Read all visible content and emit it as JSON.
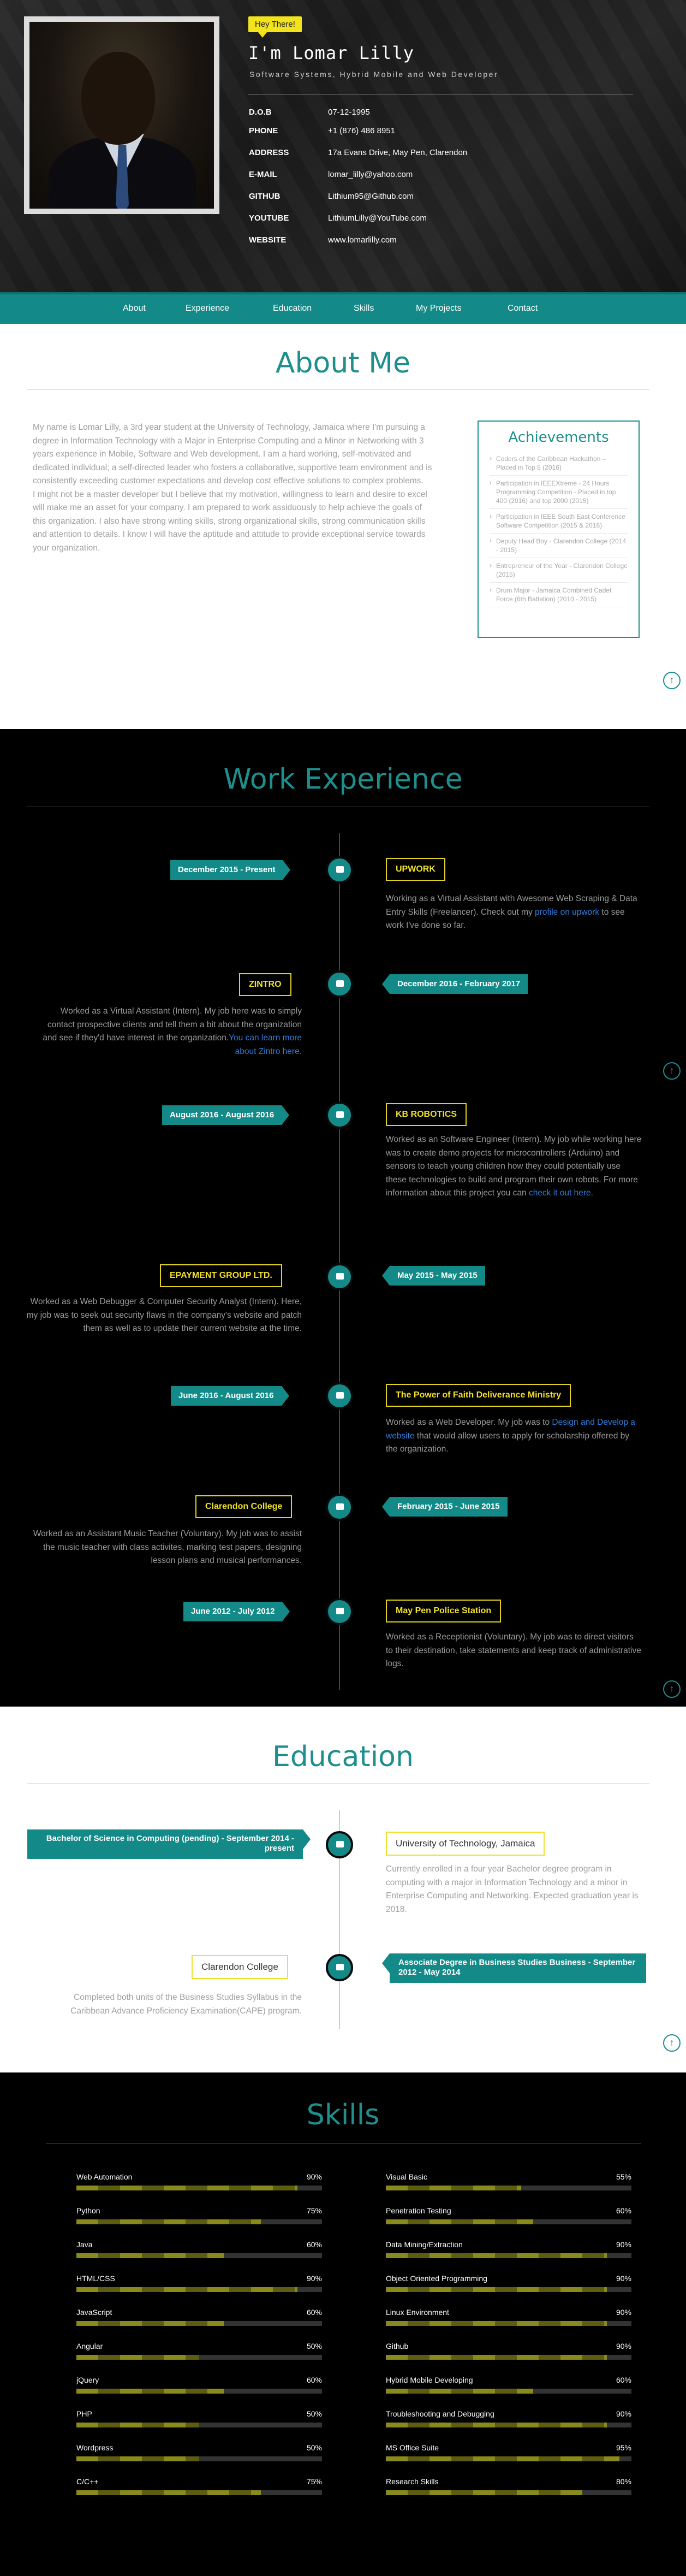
{
  "hero": {
    "badge": "Hey There!",
    "name": "I'm Lomar Lilly",
    "tagline": "Software Systems, Hybrid Mobile and Web Developer",
    "info": [
      {
        "k": "D.O.B",
        "v": "07-12-1995"
      },
      {
        "k": "PHONE",
        "v": "+1 (876) 486 8951"
      },
      {
        "k": "ADDRESS",
        "v": "17a Evans Drive, May Pen, Clarendon"
      },
      {
        "k": "E-MAIL",
        "v": "lomar_lilly@yahoo.com"
      },
      {
        "k": "GITHUB",
        "v": "Lithium95@Github.com"
      },
      {
        "k": "YOUTUBE",
        "v": "LithiumLilly@YouTube.com"
      },
      {
        "k": "WEBSITE",
        "v": "www.lomarlilly.com"
      }
    ]
  },
  "nav": [
    "About",
    "Experience",
    "Education",
    "Skills",
    "My Projects",
    "Contact"
  ],
  "about": {
    "title": "About Me",
    "p1": "My name is Lomar Lilly, a 3rd year student at the University of Technology, Jamaica where I'm pursuing a degree in Information Technology with a Major in Enterprise Computing and a Minor in Networking with 3 years experience in Mobile, Software and Web development. I am a hard working, self-motivated and dedicated individual; a self-directed leader who fosters a collaborative, supportive team environment and is consistently exceeding customer expectations and develop cost effective solutions to complex problems.",
    "p2": "I might not be a master developer but I believe that my motivation, willingness to learn and desire to excel will make me an asset for your company. I am prepared to work assiduously to help achieve the goals of this organization. I also have strong writing skills, strong organizational skills, strong communication skills and attention to details. I know I will have the aptitude and attitude to provide exceptional service towards your organization.",
    "ach_title": "Achievements",
    "achievements": [
      "Coders of the Caribbean Hackathon – Placed in Top 5 (2016)",
      "Participation in IEEEXtreme - 24 Hours Programming Competition - Placed in top 400 (2016) and top 2000 (2015)",
      "Participation in IEEE South East Conference Software Competition (2015 & 2016)",
      "Deputy Head Boy - Clarendon College (2014 - 2015)",
      "Entrepreneur of the Year - Clarendon College (2015)",
      "Drum Major - Jamaica Combined Cadet Force (6th Battalion) (2010 - 2015)"
    ]
  },
  "work": {
    "title": "Work Experience",
    "items": [
      {
        "date": "December 2015 - Present",
        "company": "UPWORK",
        "desc": "Working as a Virtual Assistant with Awesome Web Scraping & Data Entry Skills (Freelancer). Check out my ",
        "link": "profile on upwork",
        "after": " to see work I've done so far."
      },
      {
        "date": "December 2016 - February 2017",
        "company": "ZINTRO",
        "desc": "Worked as a Virtual Assistant (Intern). My job here was to simply contact prospective clients and tell them a bit about the organization and see if they'd have interest in the organization.",
        "link": "You can learn more about Zintro here.",
        "after": ""
      },
      {
        "date": "August 2016 - August 2016",
        "company": "KB ROBOTICS",
        "desc": "Worked as an Software Engineer (Intern). My job while working here was to create demo projects for microcontrollers (Arduino) and sensors to teach young children how they could potentially use these technologies to build and program their own robots. For more information about this project you can ",
        "link": "check it out here.",
        "after": ""
      },
      {
        "date": "May 2015 - May 2015",
        "company": "EPAYMENT GROUP LTD.",
        "desc": "Worked as a Web Debugger & Computer Security Analyst (Intern). Here, my job was to seek out security flaws in the company's website and patch them as well as to update their current website at the time.",
        "link": "",
        "after": ""
      },
      {
        "date": "June 2016 - August 2016",
        "company": "The Power of Faith Deliverance Ministry",
        "desc": "Worked as a Web Developer. My job was to ",
        "link": "Design and Develop a website",
        "after": " that would allow users to apply for scholarship offered by the organization."
      },
      {
        "date": "February 2015 - June 2015",
        "company": "Clarendon College",
        "desc": "Worked as an Assistant Music Teacher (Voluntary). My job was to assist the music teacher with class activites, marking test papers, designing lesson plans and musical performances.",
        "link": "",
        "after": ""
      },
      {
        "date": "June 2012 - July 2012",
        "company": "May Pen Police Station",
        "desc": "Worked as a Receptionist (Voluntary). My job was to direct visitors to their destination, take statements and keep track of administrative logs.",
        "link": "",
        "after": ""
      }
    ]
  },
  "edu": {
    "title": "Education",
    "items": [
      {
        "date": "Bachelor of Science in Computing (pending) - September 2014 - present",
        "school": "University of Technology, Jamaica",
        "desc": "Currently enrolled in a four year Bachelor degree program in computing with a major in Information Technology and a minor in Enterprise Computing and Networking. Expected graduation year is 2018."
      },
      {
        "date": "Associate Degree in Business Studies Business - September 2012 - May 2014",
        "school": "Clarendon College",
        "desc": "Completed both units of the Business Studies Syllabus in the Caribbean Advance Proficiency Examination(CAPE) program."
      }
    ]
  },
  "skills": {
    "title": "Skills",
    "left": [
      {
        "n": "Web Automation",
        "p": "90%",
        "v": 90
      },
      {
        "n": "Python",
        "p": "75%",
        "v": 75
      },
      {
        "n": "Java",
        "p": "60%",
        "v": 60
      },
      {
        "n": "HTML/CSS",
        "p": "90%",
        "v": 90
      },
      {
        "n": "JavaScript",
        "p": "60%",
        "v": 60
      },
      {
        "n": "Angular",
        "p": "50%",
        "v": 50
      },
      {
        "n": "jQuery",
        "p": "60%",
        "v": 60
      },
      {
        "n": "PHP",
        "p": "50%",
        "v": 50
      },
      {
        "n": "Wordpress",
        "p": "50%",
        "v": 50
      },
      {
        "n": "C/C++",
        "p": "75%",
        "v": 75
      }
    ],
    "right": [
      {
        "n": "Visual Basic",
        "p": "55%",
        "v": 55
      },
      {
        "n": "Penetration Testing",
        "p": "60%",
        "v": 60
      },
      {
        "n": "Data Mining/Extraction",
        "p": "90%",
        "v": 90
      },
      {
        "n": "Object Oriented Programming",
        "p": "90%",
        "v": 90
      },
      {
        "n": "Linux Environment",
        "p": "90%",
        "v": 90
      },
      {
        "n": "Github",
        "p": "90%",
        "v": 90
      },
      {
        "n": "Hybrid Mobile Developing",
        "p": "60%",
        "v": 60
      },
      {
        "n": "Troubleshooting and Debugging",
        "p": "90%",
        "v": 90
      },
      {
        "n": "MS Office Suite",
        "p": "95%",
        "v": 95
      },
      {
        "n": "Research Skills",
        "p": "80%",
        "v": 80
      }
    ]
  }
}
